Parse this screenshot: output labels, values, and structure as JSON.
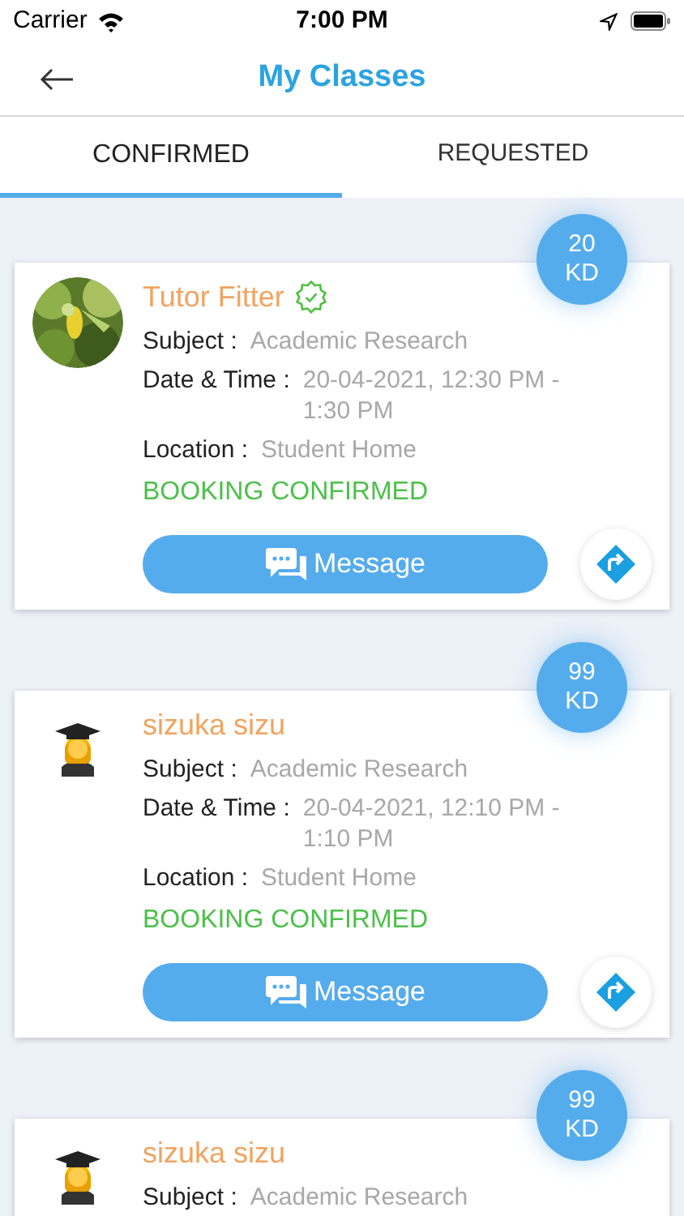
{
  "status_bar": {
    "carrier": "Carrier",
    "time": "7:00 PM"
  },
  "header": {
    "title": "My Classes"
  },
  "tabs": [
    {
      "label": "CONFIRMED",
      "selected": true
    },
    {
      "label": "REQUESTED",
      "selected": false
    }
  ],
  "classes": [
    {
      "price": "20",
      "currency": "KD",
      "name": "Tutor Fitter",
      "verified": true,
      "rows": [
        {
          "label": "Subject :",
          "value": "Academic Research"
        },
        {
          "label": "Date & Time :",
          "value": "20-04-2021, 12:30 PM - 1:30 PM"
        },
        {
          "label": "Location :",
          "value": "Student Home"
        }
      ],
      "status": "BOOKING CONFIRMED",
      "message": "Message"
    },
    {
      "price": "99",
      "currency": "KD",
      "avatar": {
        "kind": "figure"
      },
      "name": "sizuka sizu",
      "verified": false,
      "rows": [
        {
          "label": "Subject :",
          "value": "Academic Research"
        },
        {
          "label": "Date & Time :",
          "value": "20-04-2021, 12:10 PM - 1:10 PM"
        },
        {
          "label": "Location :",
          "value": "Student Home"
        }
      ],
      "status": "BOOKING CONFIRMED",
      "message": "Message"
    },
    {
      "price": "99",
      "currency": "KD",
      "avatar": {
        "kind": "figure"
      },
      "name": "sizuka sizu",
      "verified": false,
      "rows": [
        {
          "label": "Subject :",
          "value": "Academic Research"
        }
      ]
    }
  ]
}
